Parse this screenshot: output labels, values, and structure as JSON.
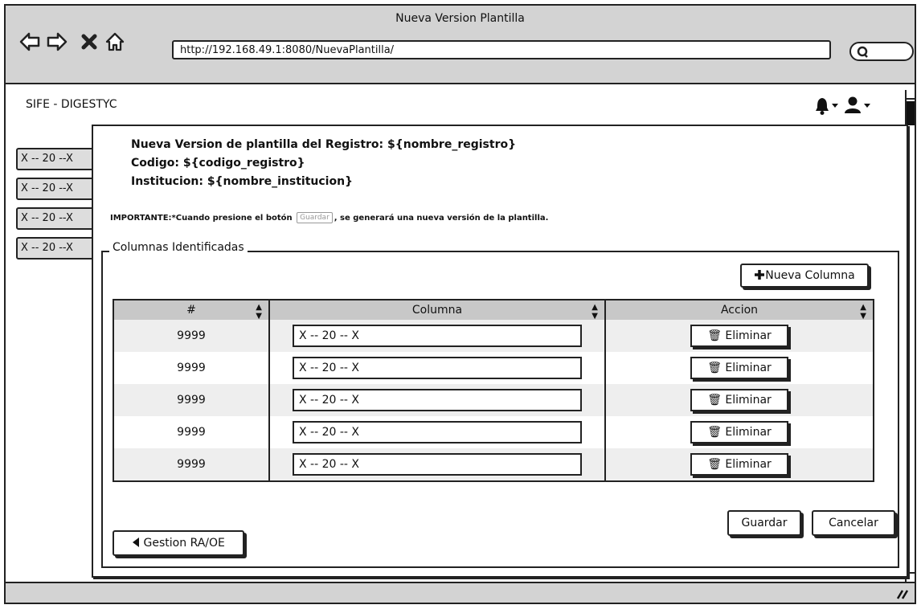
{
  "window": {
    "title": "Nueva Version Plantilla"
  },
  "browser": {
    "url": "http://192.168.49.1:8080/NuevaPlantilla/"
  },
  "app": {
    "brand": "SIFE - DIGESTYC"
  },
  "side_tabs": [
    "X -- 20 --X",
    "X -- 20 --X",
    "X -- 20 --X",
    "X -- 20 --X"
  ],
  "header": {
    "line1": "Nueva Version de plantilla del Registro: ${nombre_registro}",
    "line2": "Codigo: ${codigo_registro}",
    "line3": "Institucion: ${nombre_institucion}"
  },
  "important": {
    "prefix": "IMPORTANTE:*Cuando presione el botón",
    "button": "Guardar",
    "suffix": ", se generará una nueva versión de la plantilla."
  },
  "section": {
    "legend": "Columnas Identificadas"
  },
  "new_column_label": "Nueva Columna",
  "table": {
    "headers": [
      "#",
      "Columna",
      "Accion"
    ],
    "rows": [
      {
        "num": "9999",
        "value": "X -- 20 -- X",
        "action": "Eliminar"
      },
      {
        "num": "9999",
        "value": "X -- 20 -- X",
        "action": "Eliminar"
      },
      {
        "num": "9999",
        "value": "X -- 20 -- X",
        "action": "Eliminar"
      },
      {
        "num": "9999",
        "value": "X -- 20 -- X",
        "action": "Eliminar"
      },
      {
        "num": "9999",
        "value": "X -- 20 -- X",
        "action": "Eliminar"
      }
    ]
  },
  "actions": {
    "save": "Guardar",
    "cancel": "Cancelar",
    "back": "Gestion RA/OE"
  },
  "icons": {
    "back": "arrow-left-icon",
    "forward": "arrow-right-icon",
    "stop": "close-icon",
    "home": "home-icon",
    "search": "search-icon",
    "bell": "bell-icon",
    "user": "user-icon",
    "plus": "plus-icon",
    "trash": "trash-icon",
    "caret": "caret-left-icon"
  }
}
